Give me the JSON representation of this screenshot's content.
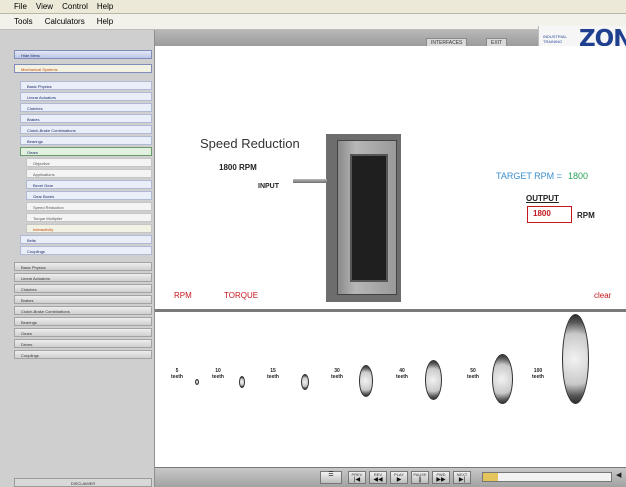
{
  "menubar": {
    "items": [
      "File",
      "View",
      "Control",
      "Help"
    ]
  },
  "menubar2": {
    "items": [
      "Tools",
      "Calculators",
      "Help"
    ]
  },
  "header": {
    "btn1": "INTERFACES",
    "btn2": "EXIT"
  },
  "logo": {
    "brand": "INDUSTRIAL TRAINING",
    "mark": "ZONe"
  },
  "sidebar": {
    "items": [
      "Hide Menu",
      "Mechanical Systems",
      "Basic Physics",
      "Linear Actuators",
      "Clutches",
      "Brakes",
      "Clutch-Brake Combinations",
      "Bearings",
      "Gears",
      "Objective",
      "Applications",
      "Bevel Gear",
      "Gear Boxes",
      "Speed Reduction",
      "Torque Multiplier",
      "Interactivity",
      "Belts",
      "Couplings",
      "Basic Physics",
      "Linear Actuators",
      "Clutches",
      "Brakes",
      "Clutch-Brake Combinations",
      "Bearings",
      "Gears",
      "Drives",
      "Couplings"
    ],
    "disclaimer": "DISCLAIMER"
  },
  "main": {
    "title": "Speed Reduction",
    "input_rpm": "1800 RPM",
    "input_label": "INPUT",
    "target_label": "TARGET RPM =",
    "target_value": "1800",
    "output_label": "OUTPUT",
    "output_value": "1800",
    "output_unit": "RPM",
    "tab_rpm": "RPM",
    "tab_torque": "TORQUE",
    "clear": "clear"
  },
  "gears": [
    {
      "n": "5",
      "unit": "teeth"
    },
    {
      "n": "10",
      "unit": "teeth"
    },
    {
      "n": "15",
      "unit": "teeth"
    },
    {
      "n": "30",
      "unit": "teeth"
    },
    {
      "n": "40",
      "unit": "teeth"
    },
    {
      "n": "50",
      "unit": "teeth"
    },
    {
      "n": "100",
      "unit": "teeth"
    }
  ],
  "footer": {
    "buttons": [
      {
        "label": "PREV",
        "glyph": "|◀"
      },
      {
        "label": "REV",
        "glyph": "◀◀"
      },
      {
        "label": "PLAY",
        "glyph": "▶"
      },
      {
        "label": "PAUSE",
        "glyph": "||"
      },
      {
        "label": "FWD",
        "glyph": "▶▶"
      },
      {
        "label": "NEXT",
        "glyph": "▶|"
      }
    ],
    "progress": 0.12,
    "volume_icon": "◀"
  },
  "colors": {
    "accent_red": "#c4161c",
    "target_blue": "#3a8fd0",
    "target_green": "#27a35a",
    "brand_blue": "#1f3f8f"
  }
}
